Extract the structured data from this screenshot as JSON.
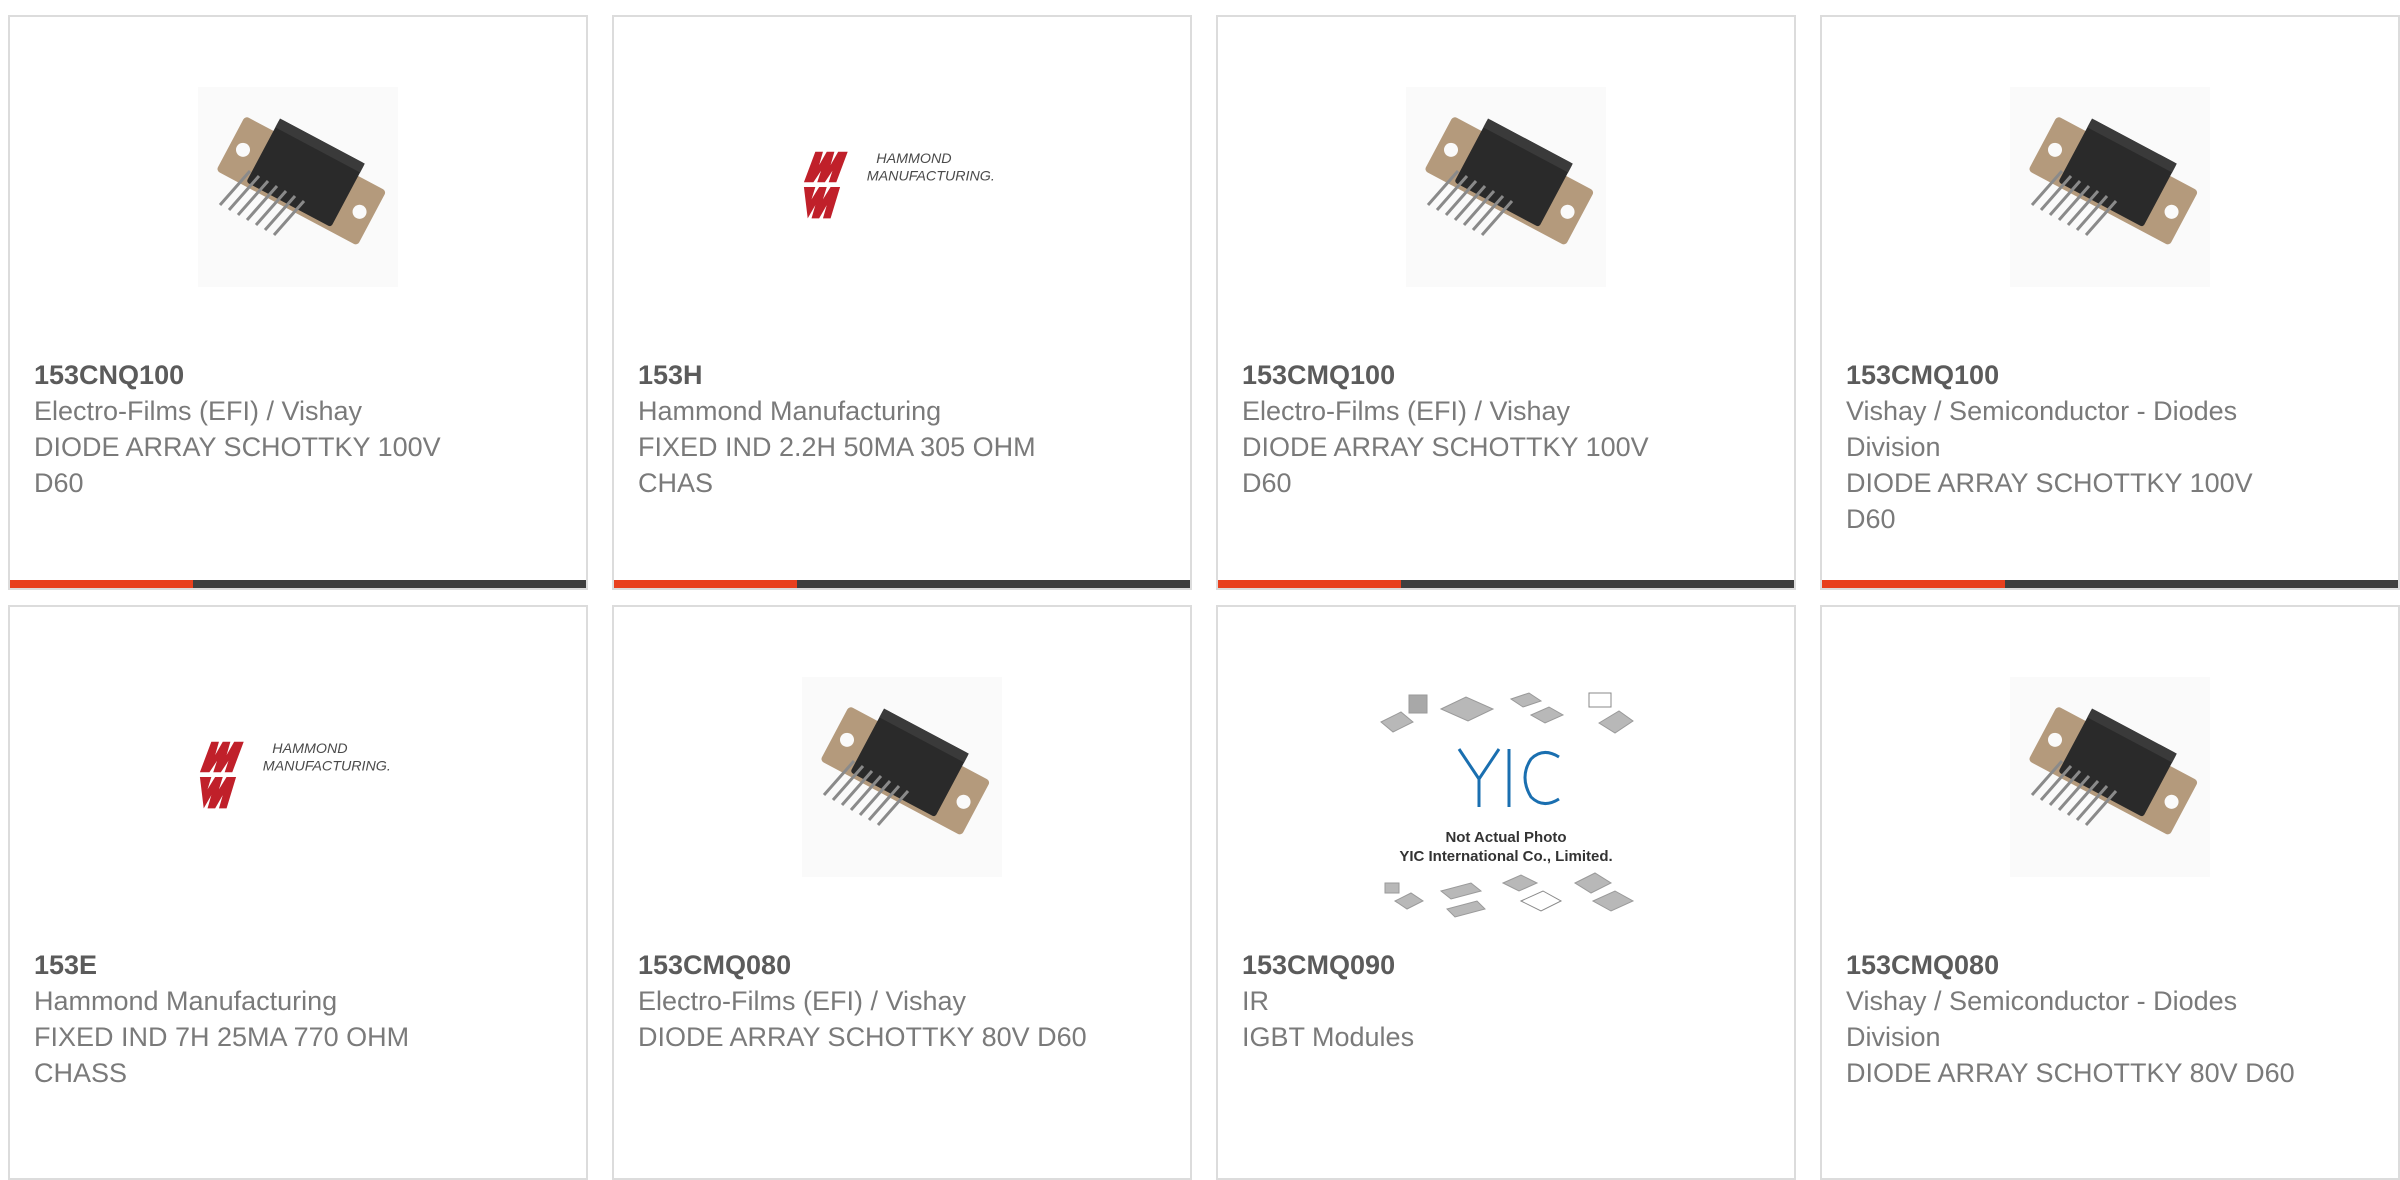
{
  "colors": {
    "accent": "#e8401e",
    "bar": "#3f3f3f",
    "border": "#dcdcdc",
    "text": "#7a7a7a",
    "part_number": "#5b5b5b"
  },
  "cards": [
    {
      "part_number": "153CNQ100",
      "manufacturer": "Electro-Films (EFI) / Vishay",
      "description": "DIODE ARRAY SCHOTTKY 100V D60",
      "image": "diode-module-image"
    },
    {
      "part_number": "153H",
      "manufacturer": "Hammond Manufacturing",
      "description": "FIXED IND 2.2H 50MA 305 OHM CHAS",
      "image": "hammond-logo",
      "logo_text": "HAMMOND MANUFACTURING"
    },
    {
      "part_number": "153CMQ100",
      "manufacturer": "Electro-Films (EFI) / Vishay",
      "description": "DIODE ARRAY SCHOTTKY 100V D60",
      "image": "diode-module-image"
    },
    {
      "part_number": "153CMQ100",
      "manufacturer": "Vishay / Semiconductor - Diodes Division",
      "description": "DIODE ARRAY SCHOTTKY 100V D60",
      "image": "diode-module-image"
    },
    {
      "part_number": "153E",
      "manufacturer": "Hammond Manufacturing",
      "description": "FIXED IND 7H 25MA 770 OHM CHASS",
      "image": "hammond-logo",
      "logo_text": "HAMMOND MANUFACTURING"
    },
    {
      "part_number": "153CMQ080",
      "manufacturer": "Electro-Films (EFI) / Vishay",
      "description": "DIODE ARRAY SCHOTTKY 80V D60",
      "image": "diode-module-image"
    },
    {
      "part_number": "153CMQ090",
      "manufacturer": "IR",
      "description": "IGBT Modules",
      "image": "yic-placeholder-image",
      "placeholder_line1": "Not Actual Photo",
      "placeholder_line2": "YIC International Co., Limited."
    },
    {
      "part_number": "153CMQ080",
      "manufacturer": "Vishay / Semiconductor - Diodes Division",
      "description": "DIODE ARRAY SCHOTTKY 80V D60",
      "image": "diode-module-image"
    }
  ]
}
